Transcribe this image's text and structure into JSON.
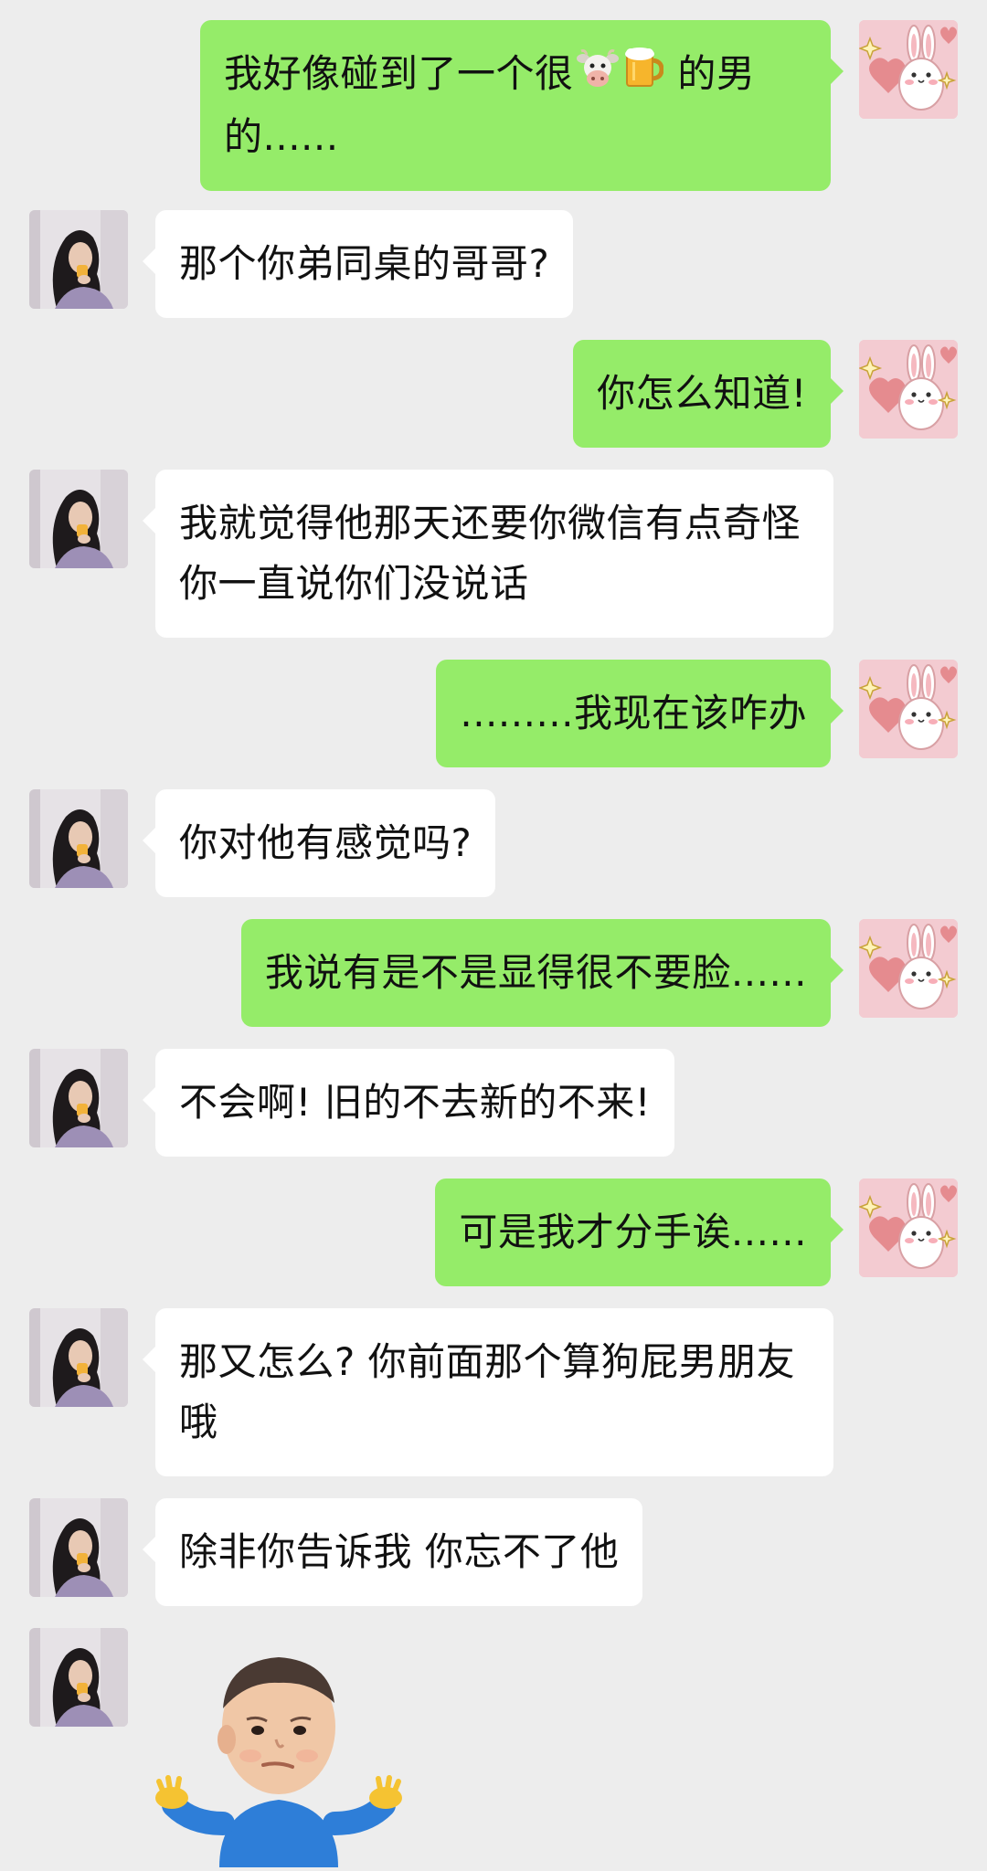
{
  "messages": [
    {
      "sender": "me",
      "text_a": "我好像碰到了一个很",
      "emoji_a": "cow-face",
      "emoji_b": "beer-mug",
      "text_b": " 的男的......"
    },
    {
      "sender": "friend",
      "text": "那个你弟同桌的哥哥?"
    },
    {
      "sender": "me",
      "text": "你怎么知道!"
    },
    {
      "sender": "friend",
      "text": "我就觉得他那天还要你微信有点奇怪 你一直说你们没说话"
    },
    {
      "sender": "me",
      "text": ".........我现在该咋办"
    },
    {
      "sender": "friend",
      "text": "你对他有感觉吗?"
    },
    {
      "sender": "me",
      "text": "我说有是不是显得很不要脸......"
    },
    {
      "sender": "friend",
      "text": "不会啊! 旧的不去新的不来!"
    },
    {
      "sender": "me",
      "text": "可是我才分手诶......"
    },
    {
      "sender": "friend",
      "text": "那又怎么? 你前面那个算狗屁男朋友哦"
    },
    {
      "sender": "friend",
      "text": "除非你告诉我 你忘不了他"
    },
    {
      "sender": "friend",
      "sticker": "shrugging-toddler-sticker"
    }
  ],
  "colors": {
    "background": "#ededed",
    "me_bubble": "#95ec69",
    "friend_bubble": "#ffffff"
  },
  "icons": {
    "me_avatar": "bunny-avatar-icon",
    "friend_avatar": "girl-photo-avatar",
    "emoji_1": "cow-face-icon",
    "emoji_2": "beer-mug-icon"
  }
}
